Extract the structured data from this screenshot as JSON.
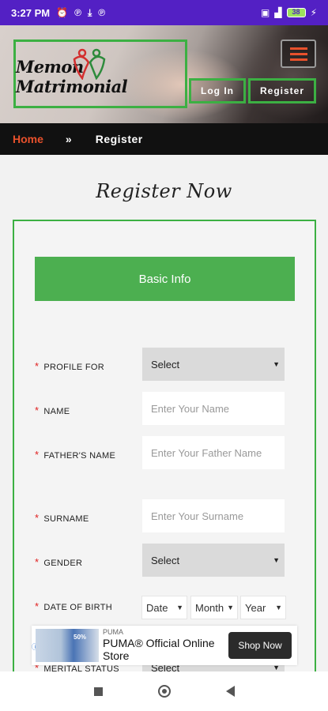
{
  "status_bar": {
    "time": "3:27 PM",
    "icons_left": [
      "alarm-icon",
      "p-icon",
      "download-icon",
      "p-icon"
    ],
    "icons_right": [
      "sim-icon",
      "signal-icon",
      "battery-icon"
    ],
    "battery": "38"
  },
  "header": {
    "logo_text": "Memon Matrimonial",
    "login_label": "Log In",
    "register_label": "Register"
  },
  "breadcrumb": {
    "home": "Home",
    "separator": "»",
    "current": "Register"
  },
  "page_title": "Register Now",
  "form": {
    "section_title": "Basic Info",
    "required_mark": "*",
    "fields": {
      "profile_for": {
        "label": "PROFILE FOR",
        "value": "Select"
      },
      "name": {
        "label": "NAME",
        "placeholder": "Enter Your Name"
      },
      "fathers_name": {
        "label": "FATHER'S NAME",
        "placeholder": "Enter Your Father Name"
      },
      "surname": {
        "label": "SURNAME",
        "placeholder": "Enter Your Surname"
      },
      "gender": {
        "label": "GENDER",
        "value": "Select"
      },
      "dob": {
        "label": "DATE OF BIRTH",
        "date": "Date",
        "month": "Month",
        "year": "Year"
      },
      "marital_status": {
        "label": "MERITAL STATUS",
        "value": "Select"
      }
    }
  },
  "ad": {
    "brand": "PUMA",
    "headline": "PUMA® Official Online Store",
    "cta": "Shop Now",
    "thumb_text": "50%"
  },
  "colors": {
    "status_bar": "#5320c4",
    "accent_green": "#4caf50",
    "border_green": "#3cb043",
    "accent_orange": "#e8512c",
    "breadcrumb_bg": "#111111"
  }
}
